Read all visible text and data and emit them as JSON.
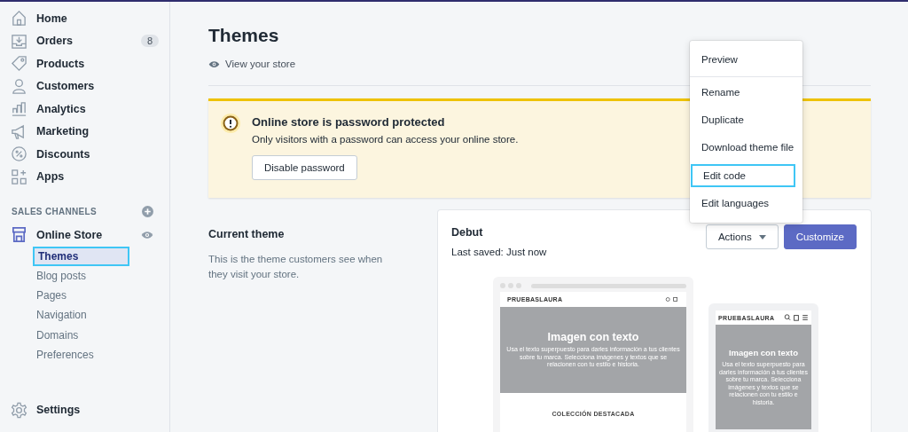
{
  "sidebar": {
    "items": [
      {
        "label": "Home"
      },
      {
        "label": "Orders",
        "badge": "8"
      },
      {
        "label": "Products"
      },
      {
        "label": "Customers"
      },
      {
        "label": "Analytics"
      },
      {
        "label": "Marketing"
      },
      {
        "label": "Discounts"
      },
      {
        "label": "Apps"
      }
    ],
    "sales_channels": {
      "heading": "SALES CHANNELS",
      "channel": "Online Store",
      "children": [
        {
          "label": "Themes",
          "selected": true
        },
        {
          "label": "Blog posts",
          "selected": false
        },
        {
          "label": "Pages",
          "selected": false
        },
        {
          "label": "Navigation",
          "selected": false
        },
        {
          "label": "Domains",
          "selected": false
        },
        {
          "label": "Preferences",
          "selected": false
        }
      ]
    },
    "settings": "Settings"
  },
  "page": {
    "title": "Themes",
    "view_link": "View your store"
  },
  "banner": {
    "title": "Online store is password protected",
    "text": "Only visitors with a password can access your online store.",
    "button": "Disable password"
  },
  "current_theme": {
    "heading": "Current theme",
    "description": "This is the theme customers see when they visit your store."
  },
  "theme_card": {
    "name": "Debut",
    "last_saved": "Last saved: Just now",
    "actions": "Actions",
    "customize": "Customize",
    "preview": {
      "store_name": "PRUEBASLAURA",
      "hero_title": "Imagen con texto",
      "hero_text": "Usa el texto superpuesto para darles información a tus clientes sobre tu marca. Selecciona imágenes y textos que se relacionen con tu estilo e historia.",
      "collection": "COLECCIÓN DESTACADA",
      "mobile_store_name": "PRUEBASLAURA",
      "mobile_hero_title": "Imagen con texto",
      "mobile_hero_text": "Usa el texto superpuesto para darles información a tus clientes sobre tu marca. Selecciona imágenes y textos que se relacionen con tu estilo e historia."
    }
  },
  "actions_menu": {
    "sections": [
      [
        {
          "label": "Preview",
          "selected": false
        }
      ],
      [
        {
          "label": "Rename",
          "selected": false
        },
        {
          "label": "Duplicate",
          "selected": false
        },
        {
          "label": "Download theme file",
          "selected": false
        },
        {
          "label": "Edit code",
          "selected": true
        },
        {
          "label": "Edit languages",
          "selected": false
        }
      ]
    ]
  }
}
